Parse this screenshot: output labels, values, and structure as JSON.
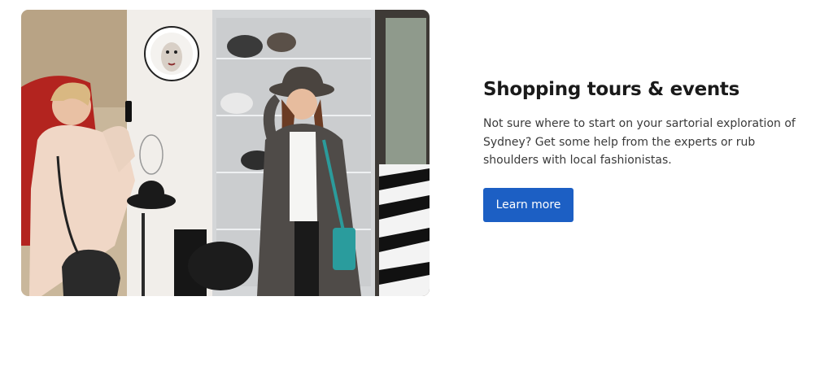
{
  "feature": {
    "heading": "Shopping tours & events",
    "description": "Not sure where to start on your sartorial exploration of Sydney? Get some help from the experts or rub shoulders with local fashionistas.",
    "cta_label": "Learn more"
  },
  "image": {
    "subject": "shopping-photo",
    "clock_icon": "clock-icon"
  },
  "colors": {
    "accent": "#1c5fc4",
    "heading": "#1a1a1a",
    "body_text": "#3a3a3a",
    "background": "#ffffff"
  }
}
